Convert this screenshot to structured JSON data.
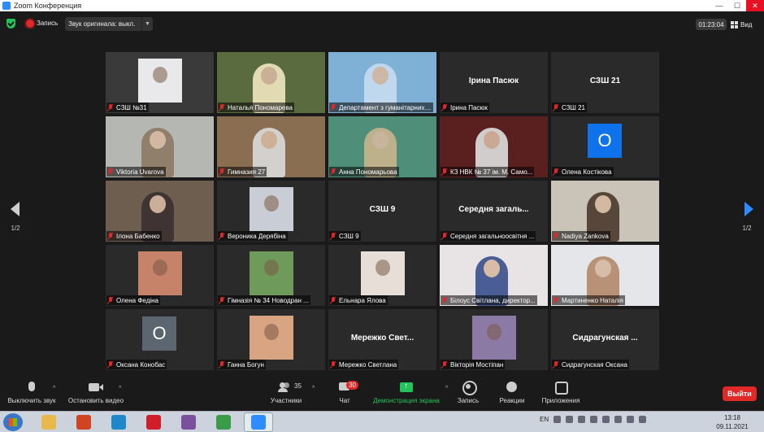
{
  "window": {
    "title": "Zoom Конференция",
    "buttons": [
      "—",
      "☐",
      "✕"
    ]
  },
  "topbar": {
    "recording_label": "Запись",
    "original_sound_label": "Звук оригинала: выкл.",
    "timer": "01:23:04",
    "view_label": "Вид"
  },
  "pagination": {
    "left": "1/2",
    "right": "1/2"
  },
  "participants": [
    {
      "name": "СЗШ №31",
      "kind": "photo",
      "bg": "#3a3a3a",
      "photo": "#e9e9ec",
      "active": false
    },
    {
      "name": "Наталья Пономарева",
      "kind": "video",
      "bg": "#5a6b3f",
      "photo": "#f0e7c0",
      "active": false
    },
    {
      "name": "Департамент з гуманітарних ...",
      "kind": "video",
      "bg": "#7fb0d6",
      "photo": "#c8ddf0",
      "active": true
    },
    {
      "name": "Ірина Пасюк",
      "kind": "text",
      "bg": "#2a2a2a",
      "display": "Ірина Пасюк",
      "active": false
    },
    {
      "name": "СЗШ 21",
      "kind": "text",
      "bg": "#2a2a2a",
      "display": "СЗШ 21",
      "active": false
    },
    {
      "name": "Viktoria Uvarova",
      "kind": "video",
      "bg": "#b5b7b2",
      "photo": "#8c7a63",
      "active": false
    },
    {
      "name": "Гимназия 27",
      "kind": "video",
      "bg": "#8a6e52",
      "photo": "#dcdcdc",
      "active": false
    },
    {
      "name": "Анна Пономарьова",
      "kind": "video",
      "bg": "#4f8f7a",
      "photo": "#c9b58f",
      "active": false
    },
    {
      "name": "КЗ НВК № 37 ім. М. Само...",
      "kind": "video",
      "bg": "#5a2020",
      "photo": "#e0e0e0",
      "active": false
    },
    {
      "name": "Олена Костікова",
      "kind": "initial",
      "bg": "#2a2a2a",
      "initial": "О",
      "initial_color": "#0e72ed",
      "active": false
    },
    {
      "name": "Ілона Бабенко",
      "kind": "video",
      "bg": "#6e5e50",
      "photo": "#3a3030",
      "active": false
    },
    {
      "name": "Вероника Дерябіна",
      "kind": "photo",
      "bg": "#2a2a2a",
      "photo": "#c9ced6",
      "active": false
    },
    {
      "name": "СЗШ 9",
      "kind": "text",
      "bg": "#2a2a2a",
      "display": "СЗШ 9",
      "active": false
    },
    {
      "name": "Середня загальноосвітня ...",
      "kind": "text",
      "bg": "#2a2a2a",
      "display": "Середня загаль...",
      "active": false
    },
    {
      "name": "Nadiya Zankova",
      "kind": "video",
      "bg": "#c9c3b8",
      "photo": "#4b3a2d",
      "active": false
    },
    {
      "name": "Олена Федіна",
      "kind": "photo",
      "bg": "#2a2a2a",
      "photo": "#c7826a",
      "active": false
    },
    {
      "name": "Гімназія № 34 Новодран ...",
      "kind": "photo",
      "bg": "#2a2a2a",
      "photo": "#6e9a5a",
      "active": false
    },
    {
      "name": "Ельнара Ялова",
      "kind": "photo",
      "bg": "#2a2a2a",
      "photo": "#e7dfd7",
      "active": false
    },
    {
      "name": "Білоус Світлана, директор...",
      "kind": "video",
      "bg": "#e8e4e6",
      "photo": "#3a4f8c",
      "active": false
    },
    {
      "name": "Мартиненко Наталія",
      "kind": "video",
      "bg": "#e4e6ea",
      "photo": "#b48a6a",
      "active": false
    },
    {
      "name": "Оксана Конобас",
      "kind": "initial",
      "bg": "#2a2a2a",
      "initial": "О",
      "initial_color": "#5b6670",
      "active": false
    },
    {
      "name": "Ганна Богун",
      "kind": "photo",
      "bg": "#2a2a2a",
      "photo": "#d9a482",
      "active": false
    },
    {
      "name": "Мережко Светлана",
      "kind": "text",
      "bg": "#2a2a2a",
      "display": "Мережко Свет...",
      "active": false
    },
    {
      "name": "Вікторія Мостіпан",
      "kind": "photo",
      "bg": "#2a2a2a",
      "photo": "#8c7aa6",
      "active": false
    },
    {
      "name": "Сидрагунская Оксана",
      "kind": "text",
      "bg": "#2a2a2a",
      "display": "Сидрагунская ...",
      "active": false
    }
  ],
  "controls": {
    "mute": "Выключить звук",
    "video": "Остановить видео",
    "participants": "Участники",
    "participants_count": "35",
    "chat": "Чат",
    "chat_badge": "30",
    "share": "Демонстрация экрана",
    "record": "Запись",
    "reactions": "Реакции",
    "apps": "Приложения",
    "end": "Выйти"
  },
  "taskbar": {
    "lang": "EN",
    "time": "13:18",
    "date": "09.11.2021",
    "apps": [
      {
        "name": "explorer",
        "color": "#e8b84a"
      },
      {
        "name": "powerpoint",
        "color": "#d04423"
      },
      {
        "name": "edge",
        "color": "#1e88c8"
      },
      {
        "name": "opera",
        "color": "#d01f2a"
      },
      {
        "name": "viber",
        "color": "#7b519d"
      },
      {
        "name": "chrome",
        "color": "#3c9a4b"
      },
      {
        "name": "zoom",
        "color": "#2d8cff"
      }
    ]
  }
}
